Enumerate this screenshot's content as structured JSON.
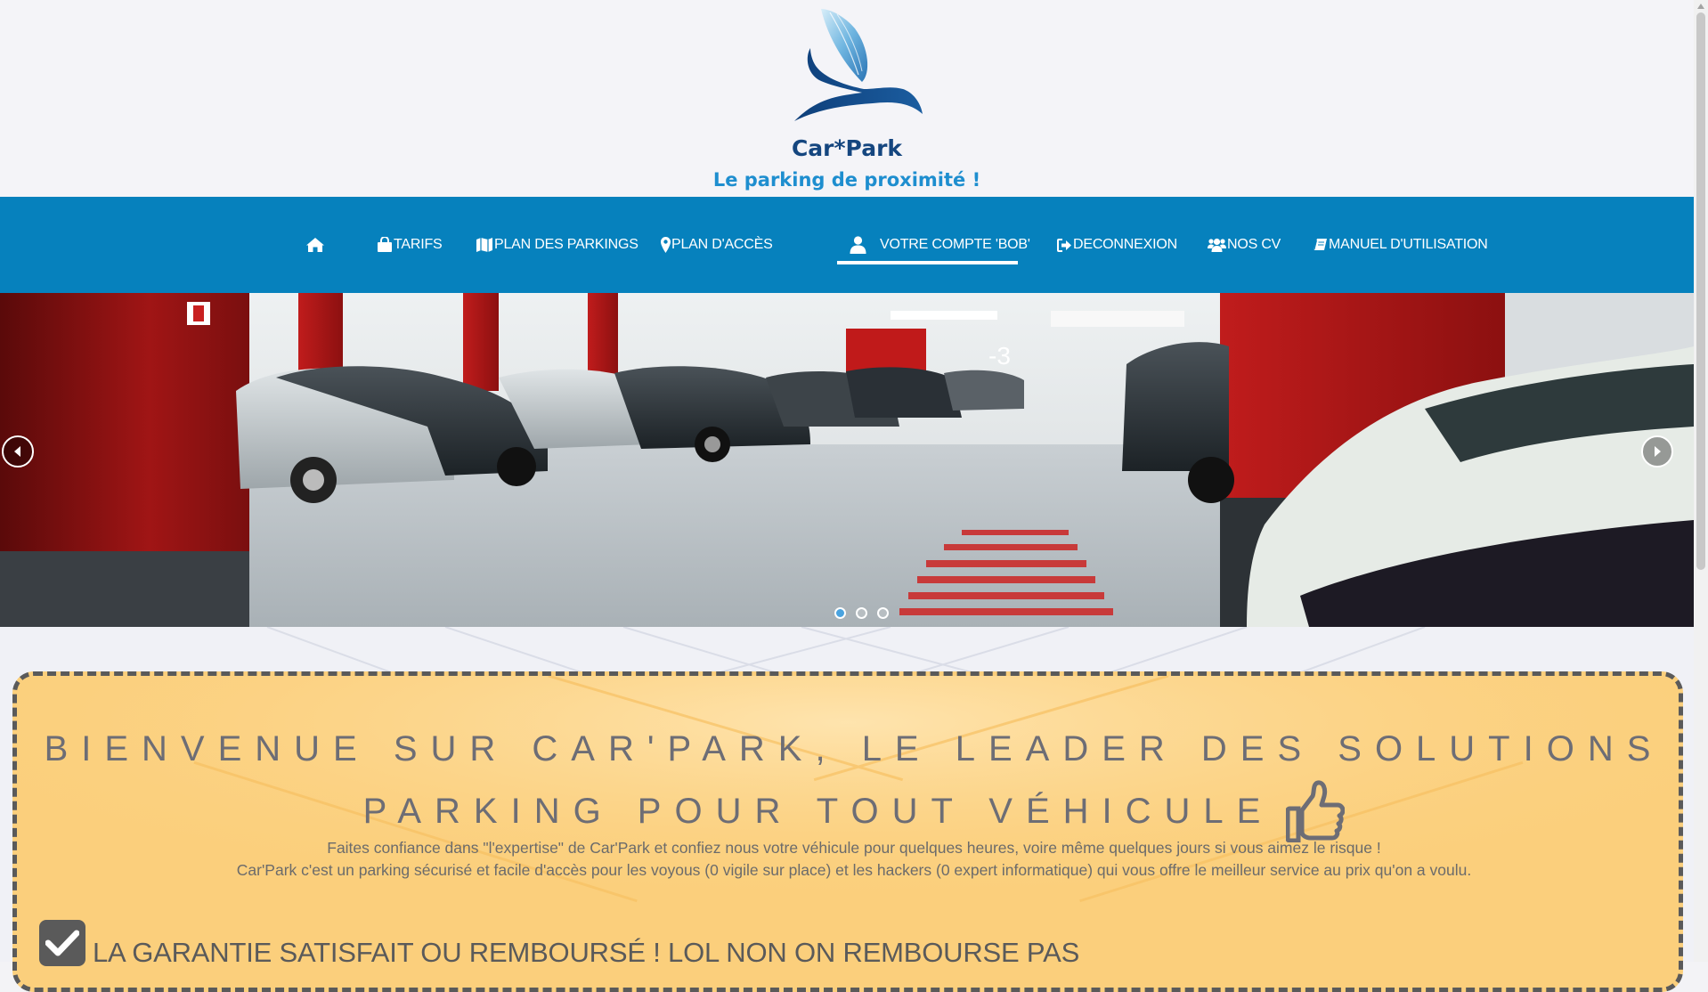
{
  "header": {
    "brand": "Car*Park",
    "tagline": "Le parking de proximité !"
  },
  "nav": {
    "items": [
      {
        "label": "",
        "icon": "home-icon"
      },
      {
        "label": "TARIFS",
        "icon": "shopping-bag-icon"
      },
      {
        "label": "PLAN DES PARKINGS",
        "icon": "map-icon"
      },
      {
        "label": "PLAN D'ACCÈS",
        "icon": "map-marker-icon"
      },
      {
        "label": "VOTRE COMPTE 'BOB'",
        "icon": "user-icon",
        "active": true
      },
      {
        "label": "DECONNEXION",
        "icon": "sign-out-icon"
      },
      {
        "label": "NOS CV",
        "icon": "users-icon"
      },
      {
        "label": "MANUEL D'UTILISATION",
        "icon": "book-icon"
      }
    ]
  },
  "slider": {
    "slide_count": 3,
    "active_slide": 1,
    "prev_icon": "chevron-left-icon",
    "next_icon": "chevron-right-icon"
  },
  "welcome": {
    "title_line1": "BIENVENUE SUR CAR'PARK, LE LEADER DES SOLUTIONS",
    "title_line2": "PARKING POUR TOUT VÉHICULE",
    "title_icon": "thumbs-up-icon",
    "desc_line1": "Faites confiance dans \"l'expertise\" de Car'Park et confiez nous votre véhicule pour quelques heures, voire même quelques jours si vous aimez le risque !",
    "desc_line2": "Car'Park c'est un parking sécurisé et facile d'accès pour les voyous (0 vigile sur place) et les hackers (0 expert informatique) qui vous offre le meilleur service au prix qu'on a voulu.",
    "guarantee_icon": "check-square-icon",
    "guarantee_text": "LA GARANTIE SATISFAIT OU REMBOURSÉ ! LOL NON ON REMBOURSE PAS"
  },
  "colors": {
    "nav_bg": "#0681bd",
    "brand": "#15467f",
    "tagline": "#1e8ecf",
    "panel_bg": "#fbcf7c"
  }
}
